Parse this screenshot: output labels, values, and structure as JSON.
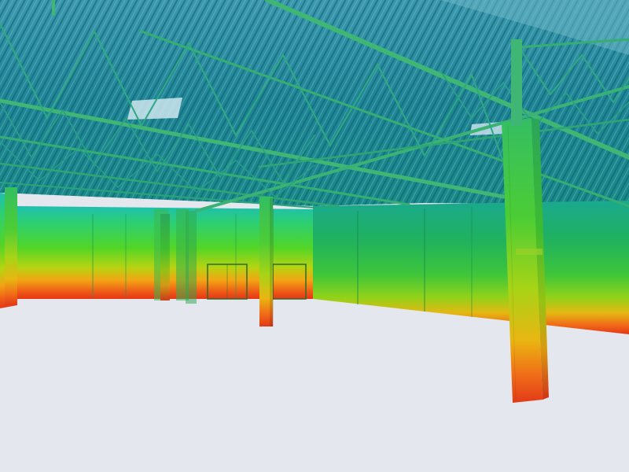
{
  "scene": {
    "subject": "warehouse-interior-point-cloud",
    "coloring": "height-colormap",
    "colors": {
      "floor": "#e4e7ee",
      "ceiling_deck": "#1e7f92",
      "ceiling_deck_light": "#4fb0b8",
      "truss": "#2aa77a",
      "truss_dark": "#1d8a6a",
      "beam": "#3fb673",
      "wall_top": "#1fb8a6",
      "wall_mid": "#33c742",
      "wall_mid2": "#5fd01e",
      "wall_low": "#c9d40f",
      "wall_bottom": "#f0781a",
      "wall_floor": "#ea3a17",
      "skylight": "#cfe6ef",
      "column_top": "#3fc35a",
      "column_bottom": "#e8521a"
    },
    "elements": [
      "ceiling-deck",
      "skylight",
      "truss",
      "back-wall",
      "right-wall",
      "left-wall",
      "door",
      "column",
      "floor"
    ]
  }
}
